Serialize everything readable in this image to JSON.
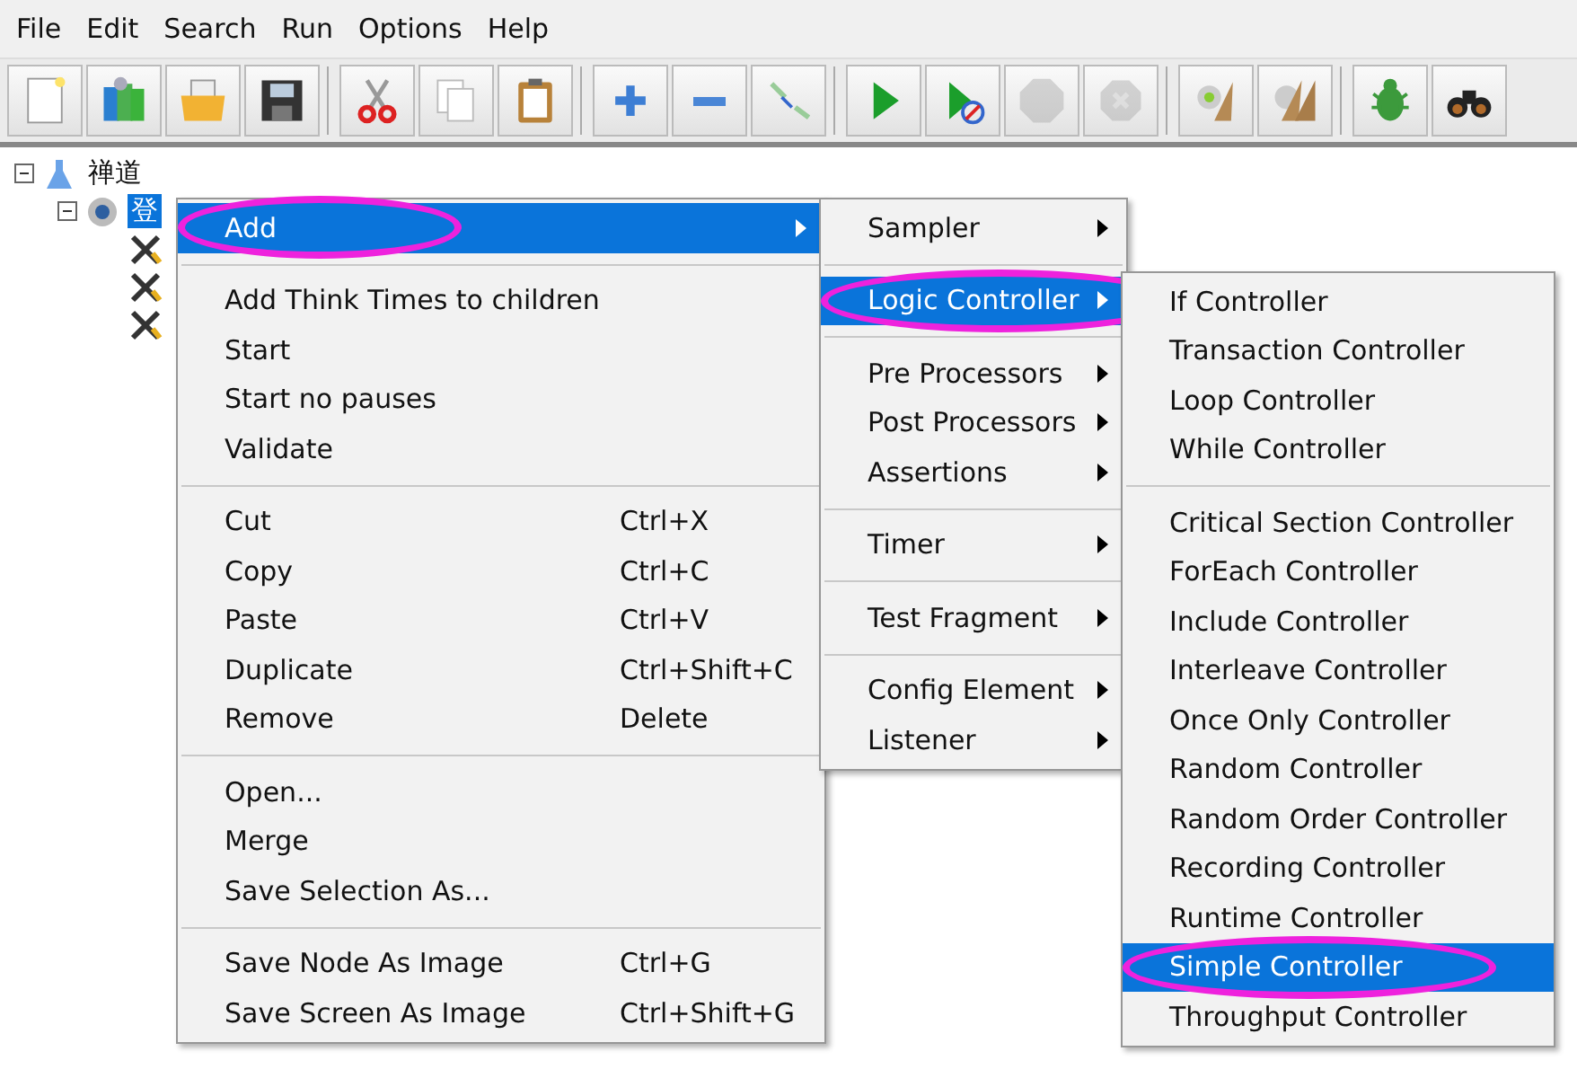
{
  "menu_bar": [
    "File",
    "Edit",
    "Search",
    "Run",
    "Options",
    "Help"
  ],
  "toolbar": [
    {
      "kind": "new",
      "disabled": false
    },
    {
      "kind": "templates",
      "disabled": false
    },
    {
      "kind": "open",
      "disabled": false
    },
    {
      "kind": "save",
      "disabled": false
    },
    {
      "kind": "separator"
    },
    {
      "kind": "cut",
      "disabled": false
    },
    {
      "kind": "copy",
      "disabled": false
    },
    {
      "kind": "paste",
      "disabled": false
    },
    {
      "kind": "separator"
    },
    {
      "kind": "expand",
      "disabled": false
    },
    {
      "kind": "collapse",
      "disabled": false
    },
    {
      "kind": "toggle",
      "disabled": false
    },
    {
      "kind": "separator"
    },
    {
      "kind": "start",
      "disabled": false
    },
    {
      "kind": "start_no_pauses",
      "disabled": false
    },
    {
      "kind": "stop",
      "disabled": true
    },
    {
      "kind": "shutdown",
      "disabled": true
    },
    {
      "kind": "separator"
    },
    {
      "kind": "clear",
      "disabled": false
    },
    {
      "kind": "clear_all",
      "disabled": false
    },
    {
      "kind": "separator"
    },
    {
      "kind": "function_helper",
      "disabled": false
    },
    {
      "kind": "search",
      "disabled": false
    }
  ],
  "tree": [
    {
      "kind": "test_plan",
      "label": "禅道",
      "selected": false,
      "expanded": true,
      "children": [
        {
          "kind": "thread_group",
          "label": "登",
          "selected": true,
          "expanded": true,
          "children": [
            {
              "kind": "sampler"
            },
            {
              "kind": "sampler"
            },
            {
              "kind": "sampler"
            }
          ]
        }
      ]
    }
  ],
  "context_menu": [
    {
      "kind": "item",
      "label": "Add",
      "submenu": true,
      "selected": true,
      "circled": true
    },
    {
      "kind": "separator"
    },
    {
      "kind": "item",
      "label": "Add Think Times to children",
      "submenu": false,
      "selected": false,
      "circled": false
    },
    {
      "kind": "item",
      "label": "Start",
      "submenu": false,
      "selected": false,
      "circled": false
    },
    {
      "kind": "item",
      "label": "Start no pauses",
      "submenu": false,
      "selected": false,
      "circled": false
    },
    {
      "kind": "item",
      "label": "Validate",
      "submenu": false,
      "selected": false,
      "circled": false
    },
    {
      "kind": "separator"
    },
    {
      "kind": "item",
      "label": "Cut",
      "shortcut": "Ctrl+X",
      "submenu": false,
      "selected": false,
      "circled": false
    },
    {
      "kind": "item",
      "label": "Copy",
      "shortcut": "Ctrl+C",
      "submenu": false,
      "selected": false,
      "circled": false
    },
    {
      "kind": "item",
      "label": "Paste",
      "shortcut": "Ctrl+V",
      "submenu": false,
      "selected": false,
      "circled": false
    },
    {
      "kind": "item",
      "label": "Duplicate",
      "shortcut": "Ctrl+Shift+C",
      "submenu": false,
      "selected": false,
      "circled": false
    },
    {
      "kind": "item",
      "label": "Remove",
      "shortcut": "Delete",
      "submenu": false,
      "selected": false,
      "circled": false
    },
    {
      "kind": "separator"
    },
    {
      "kind": "item",
      "label": "Open...",
      "submenu": false,
      "selected": false,
      "circled": false
    },
    {
      "kind": "item",
      "label": "Merge",
      "submenu": false,
      "selected": false,
      "circled": false
    },
    {
      "kind": "item",
      "label": "Save Selection As...",
      "submenu": false,
      "selected": false,
      "circled": false
    },
    {
      "kind": "separator"
    },
    {
      "kind": "item",
      "label": "Save Node As Image",
      "shortcut": "Ctrl+G",
      "submenu": false,
      "selected": false,
      "circled": false
    },
    {
      "kind": "item",
      "label": "Save Screen As Image",
      "shortcut": "Ctrl+Shift+G",
      "submenu": false,
      "selected": false,
      "circled": false
    }
  ],
  "add_submenu": [
    {
      "kind": "item",
      "label": "Sampler",
      "submenu": true,
      "selected": false,
      "circled": false
    },
    {
      "kind": "separator"
    },
    {
      "kind": "item",
      "label": "Logic Controller",
      "submenu": true,
      "selected": true,
      "circled": true
    },
    {
      "kind": "separator"
    },
    {
      "kind": "item",
      "label": "Pre Processors",
      "submenu": true,
      "selected": false,
      "circled": false
    },
    {
      "kind": "item",
      "label": "Post Processors",
      "submenu": true,
      "selected": false,
      "circled": false
    },
    {
      "kind": "item",
      "label": "Assertions",
      "submenu": true,
      "selected": false,
      "circled": false
    },
    {
      "kind": "separator"
    },
    {
      "kind": "item",
      "label": "Timer",
      "submenu": true,
      "selected": false,
      "circled": false
    },
    {
      "kind": "separator"
    },
    {
      "kind": "item",
      "label": "Test Fragment",
      "submenu": true,
      "selected": false,
      "circled": false
    },
    {
      "kind": "separator"
    },
    {
      "kind": "item",
      "label": "Config Element",
      "submenu": true,
      "selected": false,
      "circled": false
    },
    {
      "kind": "item",
      "label": "Listener",
      "submenu": true,
      "selected": false,
      "circled": false
    }
  ],
  "logic_controller_submenu": [
    {
      "kind": "item",
      "label": "If Controller",
      "submenu": false,
      "selected": false,
      "circled": false
    },
    {
      "kind": "item",
      "label": "Transaction Controller",
      "submenu": false,
      "selected": false,
      "circled": false
    },
    {
      "kind": "item",
      "label": "Loop Controller",
      "submenu": false,
      "selected": false,
      "circled": false
    },
    {
      "kind": "item",
      "label": "While Controller",
      "submenu": false,
      "selected": false,
      "circled": false
    },
    {
      "kind": "separator"
    },
    {
      "kind": "item",
      "label": "Critical Section Controller",
      "submenu": false,
      "selected": false,
      "circled": false
    },
    {
      "kind": "item",
      "label": "ForEach Controller",
      "submenu": false,
      "selected": false,
      "circled": false
    },
    {
      "kind": "item",
      "label": "Include Controller",
      "submenu": false,
      "selected": false,
      "circled": false
    },
    {
      "kind": "item",
      "label": "Interleave Controller",
      "submenu": false,
      "selected": false,
      "circled": false
    },
    {
      "kind": "item",
      "label": "Once Only Controller",
      "submenu": false,
      "selected": false,
      "circled": false
    },
    {
      "kind": "item",
      "label": "Random Controller",
      "submenu": false,
      "selected": false,
      "circled": false
    },
    {
      "kind": "item",
      "label": "Random Order Controller",
      "submenu": false,
      "selected": false,
      "circled": false
    },
    {
      "kind": "item",
      "label": "Recording Controller",
      "submenu": false,
      "selected": false,
      "circled": false
    },
    {
      "kind": "item",
      "label": "Runtime Controller",
      "submenu": false,
      "selected": false,
      "circled": false
    },
    {
      "kind": "item",
      "label": "Simple Controller",
      "submenu": false,
      "selected": true,
      "circled": true
    },
    {
      "kind": "item",
      "label": "Throughput Controller",
      "submenu": false,
      "selected": false,
      "circled": false
    }
  ]
}
